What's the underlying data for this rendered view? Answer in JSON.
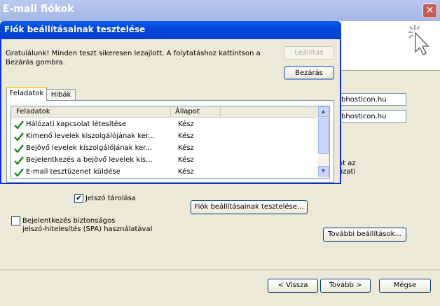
{
  "background_window": {
    "title": "E-mail fiókok",
    "close_symbol": "✕",
    "email_field_1": "bhosticon.hu",
    "email_field_2": "bhosticon.hu",
    "partial_text_1": "ot az",
    "partial_text_2": "ózati",
    "remember_password_label": "Jelszó tárolása",
    "remember_password_checked": true,
    "spa_label": "Bejelentkezés biztonságos jelszó-hitelesítés (SPA) használatával",
    "spa_label_line1": "Bejelentkezés biztonságos",
    "spa_label_line2": "jelszó-hitelesítés (SPA) használatával",
    "spa_checked": false,
    "test_settings_button": "Fiók beállításainak tesztelése...",
    "more_settings_button": "További beállítások...",
    "back_button": "< Vissza",
    "next_button": "Tovább >",
    "cancel_button": "Mégse"
  },
  "dialog": {
    "title": "Fiók beállításainak tesztelése",
    "message_line1": "Gratulálunk! Minden teszt sikeresen lezajlott. A folytatáshoz kattintson a",
    "message_line2": "Bezárás gombra.",
    "stop_button": "Leállítás",
    "close_button": "Bezárás",
    "tabs": [
      {
        "label": "Feladatok",
        "active": true
      },
      {
        "label": "Hibák",
        "active": false
      }
    ],
    "columns": [
      "Feladatok",
      "Állapot"
    ],
    "rows": [
      {
        "task": "Hálózati kapcsolat létesítése",
        "status": "Kész",
        "icon": "checkmark-icon"
      },
      {
        "task": "Kimenő levelek kiszolgálójának ker...",
        "status": "Kész",
        "icon": "checkmark-icon"
      },
      {
        "task": "Bejövő levelek kiszolgálójának ker...",
        "status": "Kész",
        "icon": "checkmark-icon"
      },
      {
        "task": "Bejelentkezés a bejövő levelek kis...",
        "status": "Kész",
        "icon": "checkmark-icon"
      },
      {
        "task": "E-mail tesztüzenet küldése",
        "status": "Kész",
        "icon": "checkmark-icon"
      }
    ]
  },
  "colors": {
    "title_blue": "#0245d8",
    "check_green": "#1a8c1a",
    "window_face": "#ece9d8"
  }
}
